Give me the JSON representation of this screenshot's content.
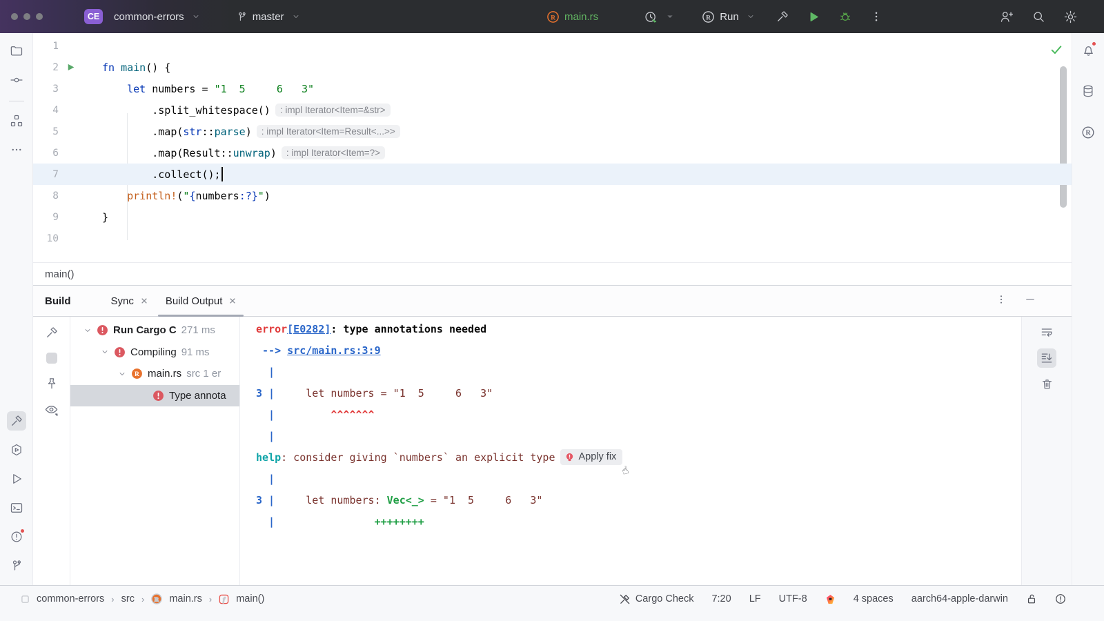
{
  "colors": {
    "accent_purple": "#8A5FD4",
    "titlebar_bg": "#2B2D30",
    "error_red": "#DB5860",
    "rust_orange": "#E8722D",
    "run_green": "#5FB865",
    "link_blue": "#2A66C9",
    "keyword_blue": "#0033B3",
    "string_green": "#067D17",
    "selection_gray": "#D5D8DD",
    "active_line": "#EBF2FA"
  },
  "titlebar": {
    "project_badge": "CE",
    "project_name": "common-errors",
    "branch": "master",
    "file": "main.rs",
    "run_label": "Run",
    "icons": [
      "window-dots",
      "project-chevron",
      "branch-icon",
      "rust-file-icon",
      "profiler-icon",
      "run-config-rust-icon",
      "build-hammer-icon",
      "run-play-icon",
      "debug-bug-icon",
      "more-kebab-icon",
      "add-user-icon",
      "search-icon",
      "settings-gear-icon"
    ]
  },
  "left_stripe_icons": [
    "project-folder",
    "commit",
    "structure",
    "more",
    "build-hammer-selected",
    "services",
    "run",
    "terminal",
    "problems-with-badge",
    "version-control"
  ],
  "right_stripe_icons": [
    "notifications-with-badge",
    "database",
    "rust-plugin"
  ],
  "editor": {
    "breadcrumb": "main()",
    "active_line": 7,
    "lines": [
      {
        "n": 1,
        "segs": []
      },
      {
        "n": 2,
        "run": true,
        "segs": [
          {
            "c": "kw",
            "t": "fn "
          },
          {
            "c": "fn",
            "t": "main"
          },
          {
            "c": "pl",
            "t": "() {"
          }
        ]
      },
      {
        "n": 3,
        "segs": [
          {
            "c": "pl",
            "t": "    "
          },
          {
            "c": "kw",
            "t": "let"
          },
          {
            "c": "pl",
            "t": " numbers = "
          },
          {
            "c": "str",
            "t": "\"1  5     6   3\""
          }
        ]
      },
      {
        "n": 4,
        "segs": [
          {
            "c": "pl",
            "t": "        .split_whitespace()"
          },
          {
            "c": "hint",
            "t": ": impl Iterator<Item=&str>"
          }
        ]
      },
      {
        "n": 5,
        "segs": [
          {
            "c": "pl",
            "t": "        .map("
          },
          {
            "c": "kw",
            "t": "str"
          },
          {
            "c": "pl",
            "t": "::"
          },
          {
            "c": "fn",
            "t": "parse"
          },
          {
            "c": "pl",
            "t": ")"
          },
          {
            "c": "hint",
            "t": ": impl Iterator<Item=Result<...>>"
          }
        ]
      },
      {
        "n": 6,
        "segs": [
          {
            "c": "pl",
            "t": "        .map(Result::"
          },
          {
            "c": "fn",
            "t": "unwrap"
          },
          {
            "c": "pl",
            "t": ")"
          },
          {
            "c": "hint",
            "t": ": impl Iterator<Item=?>"
          }
        ]
      },
      {
        "n": 7,
        "segs": [
          {
            "c": "pl",
            "t": "        .collect();"
          },
          {
            "c": "cursor",
            "t": ""
          }
        ]
      },
      {
        "n": 8,
        "segs": [
          {
            "c": "mac",
            "t": "    println!"
          },
          {
            "c": "pl",
            "t": "("
          },
          {
            "c": "str",
            "t": "\""
          },
          {
            "c": "fmt",
            "t": "{"
          },
          {
            "c": "pl",
            "t": "numbers"
          },
          {
            "c": "fmt",
            "t": ":?}"
          },
          {
            "c": "str",
            "t": "\""
          },
          {
            "c": "pl",
            "t": ")"
          }
        ]
      },
      {
        "n": 9,
        "segs": [
          {
            "c": "pl",
            "t": "}"
          }
        ]
      },
      {
        "n": 10,
        "segs": []
      }
    ]
  },
  "build": {
    "title": "Build",
    "tabs": [
      {
        "label": "Sync",
        "closable": true,
        "selected": false
      },
      {
        "label": "Build Output",
        "closable": true,
        "selected": true
      }
    ],
    "header_icons": [
      "more-kebab-icon",
      "minimize-icon"
    ],
    "toolbar_icons": [
      "build-hammer-icon",
      "stop-icon",
      "pin-icon",
      "preview-eye-icon"
    ],
    "console_toolbar_icons": [
      "soft-wrap-icon",
      "scroll-to-end-icon-selected",
      "clear-trash-icon"
    ],
    "tree_rows": [
      {
        "level": 0,
        "chevron": true,
        "icon": "error",
        "label": "Run Cargo C",
        "meta": "271 ms",
        "bold": true,
        "selected": false
      },
      {
        "level": 1,
        "chevron": true,
        "icon": "error",
        "label": "Compiling",
        "meta": "91 ms",
        "bold": false,
        "selected": false
      },
      {
        "level": 2,
        "chevron": true,
        "icon": "rust",
        "label": "main.rs",
        "meta": "src 1 er",
        "bold": false,
        "selected": false
      },
      {
        "level": 3,
        "chevron": false,
        "icon": "error",
        "label": "Type annota",
        "meta": "",
        "bold": false,
        "selected": true
      }
    ]
  },
  "console": {
    "apply_fix_label": "Apply fix",
    "lines": [
      [
        {
          "c": "err",
          "t": "error"
        },
        {
          "c": "lnk",
          "t": "[E0282]",
          "name": "error-code-link"
        },
        {
          "c": "msg",
          "t": ": type annotations needed"
        }
      ],
      [
        {
          "c": "pipe",
          "t": " --> "
        },
        {
          "c": "lnk",
          "t": "src/main.rs:3:9",
          "name": "source-location-link"
        }
      ],
      [
        {
          "c": "pipe",
          "t": "  |"
        }
      ],
      [
        {
          "c": "pipe",
          "t": "3 | "
        },
        {
          "c": "code",
          "t": "    let numbers = \"1  5     6   3\""
        }
      ],
      [
        {
          "c": "pipe",
          "t": "  | "
        },
        {
          "c": "caret",
          "t": "        ^^^^^^^"
        }
      ],
      [
        {
          "c": "pipe",
          "t": "  |"
        }
      ],
      [
        {
          "c": "help",
          "t": "help"
        },
        {
          "c": "code",
          "t": ": consider giving `numbers` an explicit type"
        },
        {
          "c": "chip",
          "t": "Apply fix"
        }
      ],
      [
        {
          "c": "pipe",
          "t": "  |"
        }
      ],
      [
        {
          "c": "pipe",
          "t": "3 | "
        },
        {
          "c": "code",
          "t": "    let numbers: "
        },
        {
          "c": "grn",
          "t": "Vec<_>"
        },
        {
          "c": "code",
          "t": " = \"1  5     6   3\""
        }
      ],
      [
        {
          "c": "pipe",
          "t": "  | "
        },
        {
          "c": "grn",
          "t": "               ++++++++"
        }
      ]
    ]
  },
  "statusbar": {
    "crumbs": [
      "common-errors",
      "src",
      "main.rs",
      "main()"
    ],
    "cargo_check": "Cargo Check",
    "position": "7:20",
    "line_separator": "LF",
    "encoding": "UTF-8",
    "indent": "4 spaces",
    "toolchain": "aarch64-apple-darwin",
    "icons": [
      "project-icon",
      "rust-file-icon",
      "function-icon",
      "cargo-check-muted-icon",
      "ai-assistant-icon",
      "unlocked-icon",
      "problems-icon"
    ]
  }
}
